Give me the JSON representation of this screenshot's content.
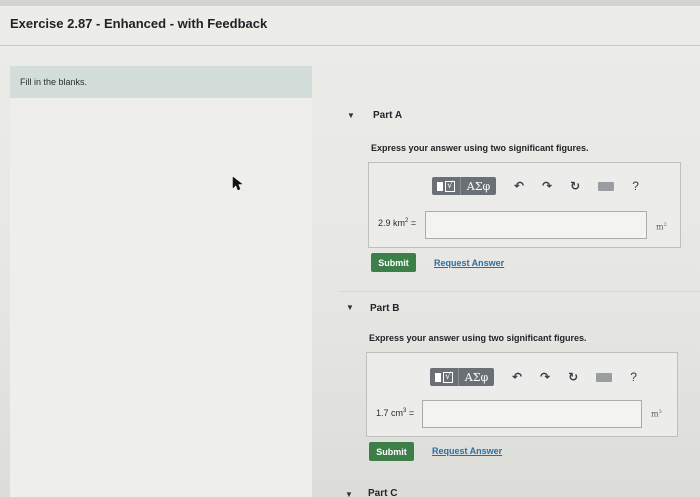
{
  "header": {
    "title": "Exercise 2.87 - Enhanced - with Feedback"
  },
  "instructions": {
    "text": "Fill in the blanks."
  },
  "toolbar": {
    "symbols_label": "ΑΣφ",
    "help_label": "?",
    "undo_icon": "undo-icon",
    "redo_icon": "redo-icon",
    "reset_icon": "reset-icon",
    "keyboard_icon": "keyboard-icon"
  },
  "parts": [
    {
      "label": "Part A",
      "prompt": "Express your answer using two significant figures.",
      "eq_value": "2.9 km",
      "eq_exp": "2",
      "eq_sign": " =",
      "input_value": "",
      "unit_base": "m",
      "unit_exp": "2",
      "submit_label": "Submit",
      "request_label": "Request Answer"
    },
    {
      "label": "Part B",
      "prompt": "Express your answer using two significant figures.",
      "eq_value": "1.7 cm",
      "eq_exp": "3",
      "eq_sign": " =",
      "input_value": "",
      "unit_base": "m",
      "unit_exp": "3",
      "submit_label": "Submit",
      "request_label": "Request Answer"
    },
    {
      "label": "Part C"
    }
  ],
  "colors": {
    "submit": "#3d7f48",
    "link": "#2b6ea3",
    "toolbar": "#6b7077",
    "instructions_bg": "#d3ddd9"
  }
}
